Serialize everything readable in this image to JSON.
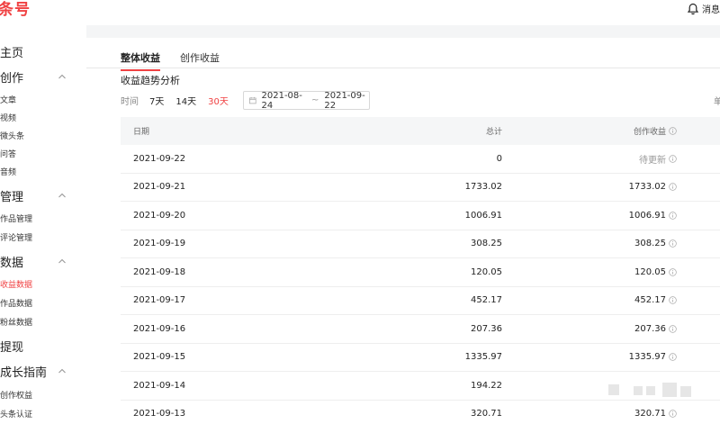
{
  "app": {
    "logo": "条号",
    "message_label": "消息"
  },
  "sidebar": {
    "items": [
      {
        "label": "主页",
        "kind": "section",
        "chevron": false
      },
      {
        "label": "创作",
        "kind": "section",
        "chevron": true
      },
      {
        "label": "文章",
        "kind": "sub"
      },
      {
        "label": "视频",
        "kind": "sub"
      },
      {
        "label": "微头条",
        "kind": "sub"
      },
      {
        "label": "问答",
        "kind": "sub"
      },
      {
        "label": "音频",
        "kind": "sub"
      },
      {
        "label": "管理",
        "kind": "section",
        "chevron": true
      },
      {
        "label": "作品管理",
        "kind": "sub"
      },
      {
        "label": "评论管理",
        "kind": "sub"
      },
      {
        "label": "数据",
        "kind": "section",
        "chevron": true
      },
      {
        "label": "收益数据",
        "kind": "sub",
        "active": true
      },
      {
        "label": "作品数据",
        "kind": "sub"
      },
      {
        "label": "粉丝数据",
        "kind": "sub"
      },
      {
        "label": "提现",
        "kind": "section",
        "chevron": false
      },
      {
        "label": "成长指南",
        "kind": "section",
        "chevron": true
      },
      {
        "label": "创作权益",
        "kind": "sub"
      },
      {
        "label": "头条认证",
        "kind": "sub"
      }
    ]
  },
  "tabs": [
    {
      "label": "整体收益",
      "active": true
    },
    {
      "label": "创作收益",
      "active": false
    }
  ],
  "section_title": "收益趋势分析",
  "filter": {
    "label": "时间",
    "ranges": [
      {
        "label": "7天",
        "active": false
      },
      {
        "label": "14天",
        "active": false
      },
      {
        "label": "30天",
        "active": true
      }
    ],
    "start_date": "2021-08-24",
    "separator": "~",
    "end_date": "2021-09-22",
    "right_clipped": "单"
  },
  "table": {
    "headers": {
      "date": "日期",
      "total": "总计",
      "income": "创作收益"
    },
    "rows": [
      {
        "date": "2021-09-22",
        "total": "0",
        "income": "待更新",
        "pending": true
      },
      {
        "date": "2021-09-21",
        "total": "1733.02",
        "income": "1733.02"
      },
      {
        "date": "2021-09-20",
        "total": "1006.91",
        "income": "1006.91"
      },
      {
        "date": "2021-09-19",
        "total": "308.25",
        "income": "308.25"
      },
      {
        "date": "2021-09-18",
        "total": "120.05",
        "income": "120.05"
      },
      {
        "date": "2021-09-17",
        "total": "452.17",
        "income": "452.17"
      },
      {
        "date": "2021-09-16",
        "total": "207.36",
        "income": "207.36"
      },
      {
        "date": "2021-09-15",
        "total": "1335.97",
        "income": "1335.97"
      },
      {
        "date": "2021-09-14",
        "total": "194.22",
        "income": ""
      },
      {
        "date": "2021-09-13",
        "total": "320.71",
        "income": "320.71"
      }
    ]
  },
  "colors": {
    "accent": "#f04142",
    "header_bg": "#f5f6f7",
    "page_bg": "#f4f5f6"
  }
}
